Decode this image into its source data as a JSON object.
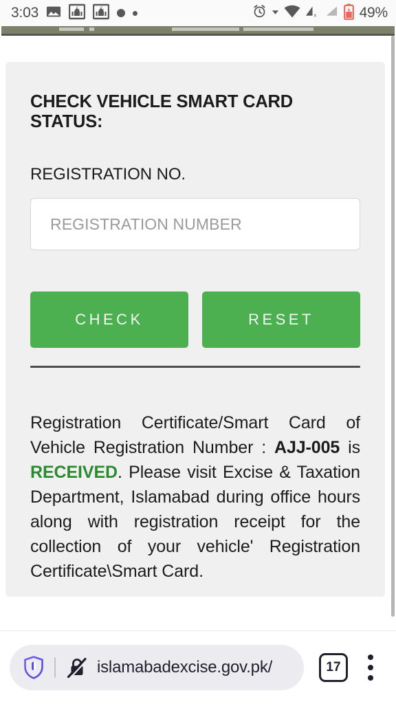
{
  "status_bar": {
    "time": "3:03",
    "battery_percent": "49%",
    "icons": [
      "photo-icon",
      "mosque-notification-icon",
      "mosque-notification-icon",
      "dot-notification-icon",
      "dot-notification-icon",
      "alarm-icon",
      "dropdown-caret-icon",
      "wifi-icon",
      "cellular-signal-no-sim-icon",
      "cellular-signal-icon",
      "battery-low-icon"
    ]
  },
  "card": {
    "title": "CHECK VEHICLE SMART CARD STATUS:",
    "field_label": "REGISTRATION NO.",
    "input": {
      "placeholder": "REGISTRATION NUMBER",
      "value": ""
    },
    "buttons": {
      "check_label": "CHECK",
      "reset_label": "RESET"
    },
    "result": {
      "part1": "Registration Certificate/Smart Card of Vehicle Registration Number : ",
      "registration_number": "AJJ-005",
      "part2": " is ",
      "status": "RECEIVED",
      "part3": ". Please visit Excise & Taxation Department, Islamabad during office hours along with registration receipt for the collection of your vehicle' Registration Certificate\\Smart Card.",
      "status_color": "#2b8a2f"
    }
  },
  "browser_bar": {
    "url": "islamabadexcise.gov.pk/",
    "tab_count": "17",
    "shield_icon": "brave-shield-icon",
    "security_icon": "lock-crossed-out-icon",
    "menu_icon": "overflow-menu-icon"
  },
  "theme": {
    "button_green": "#4CAF50",
    "card_background": "#f0f0f0",
    "site_header_strip": "#7c8169"
  }
}
